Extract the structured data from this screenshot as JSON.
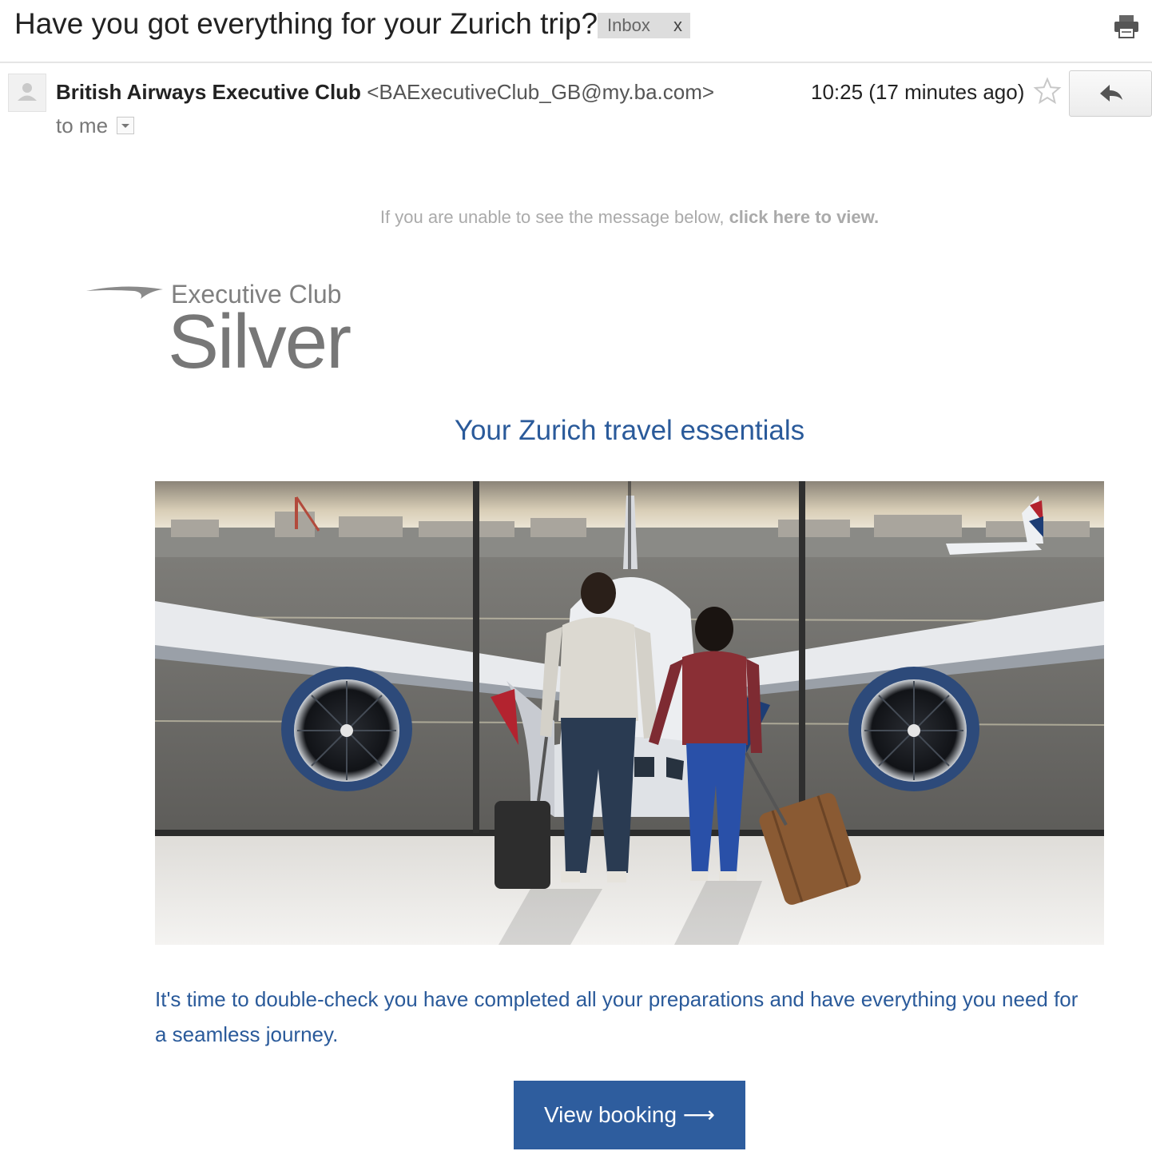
{
  "email": {
    "subject": "Have you got everything for your Zurich trip?",
    "label": "Inbox",
    "label_remove": "x",
    "sender_name": "British Airways Executive Club",
    "sender_email": "<BAExecutiveClub_GB@my.ba.com>",
    "recipient": "to me",
    "time": "10:25 (17 minutes ago)"
  },
  "icons": {
    "print": "print-icon",
    "avatar": "person-icon",
    "star": "star-outline-icon",
    "reply": "reply-arrow-icon",
    "dropdown": "chevron-down-icon"
  },
  "message": {
    "preheader": "If you are unable to see the message below,",
    "preheader_link": "click here to view.",
    "logo_club": "Executive Club",
    "logo_tier": "Silver",
    "headline": "Your Zurich travel essentials",
    "body": "It's time to double-check you have completed all your preparations and have everything you need for a seamless journey.",
    "cta": "View booking ⟶"
  },
  "colors": {
    "brand_blue": "#2e5d9e",
    "text_blue": "#2a5a9a",
    "silver": "#777777"
  }
}
